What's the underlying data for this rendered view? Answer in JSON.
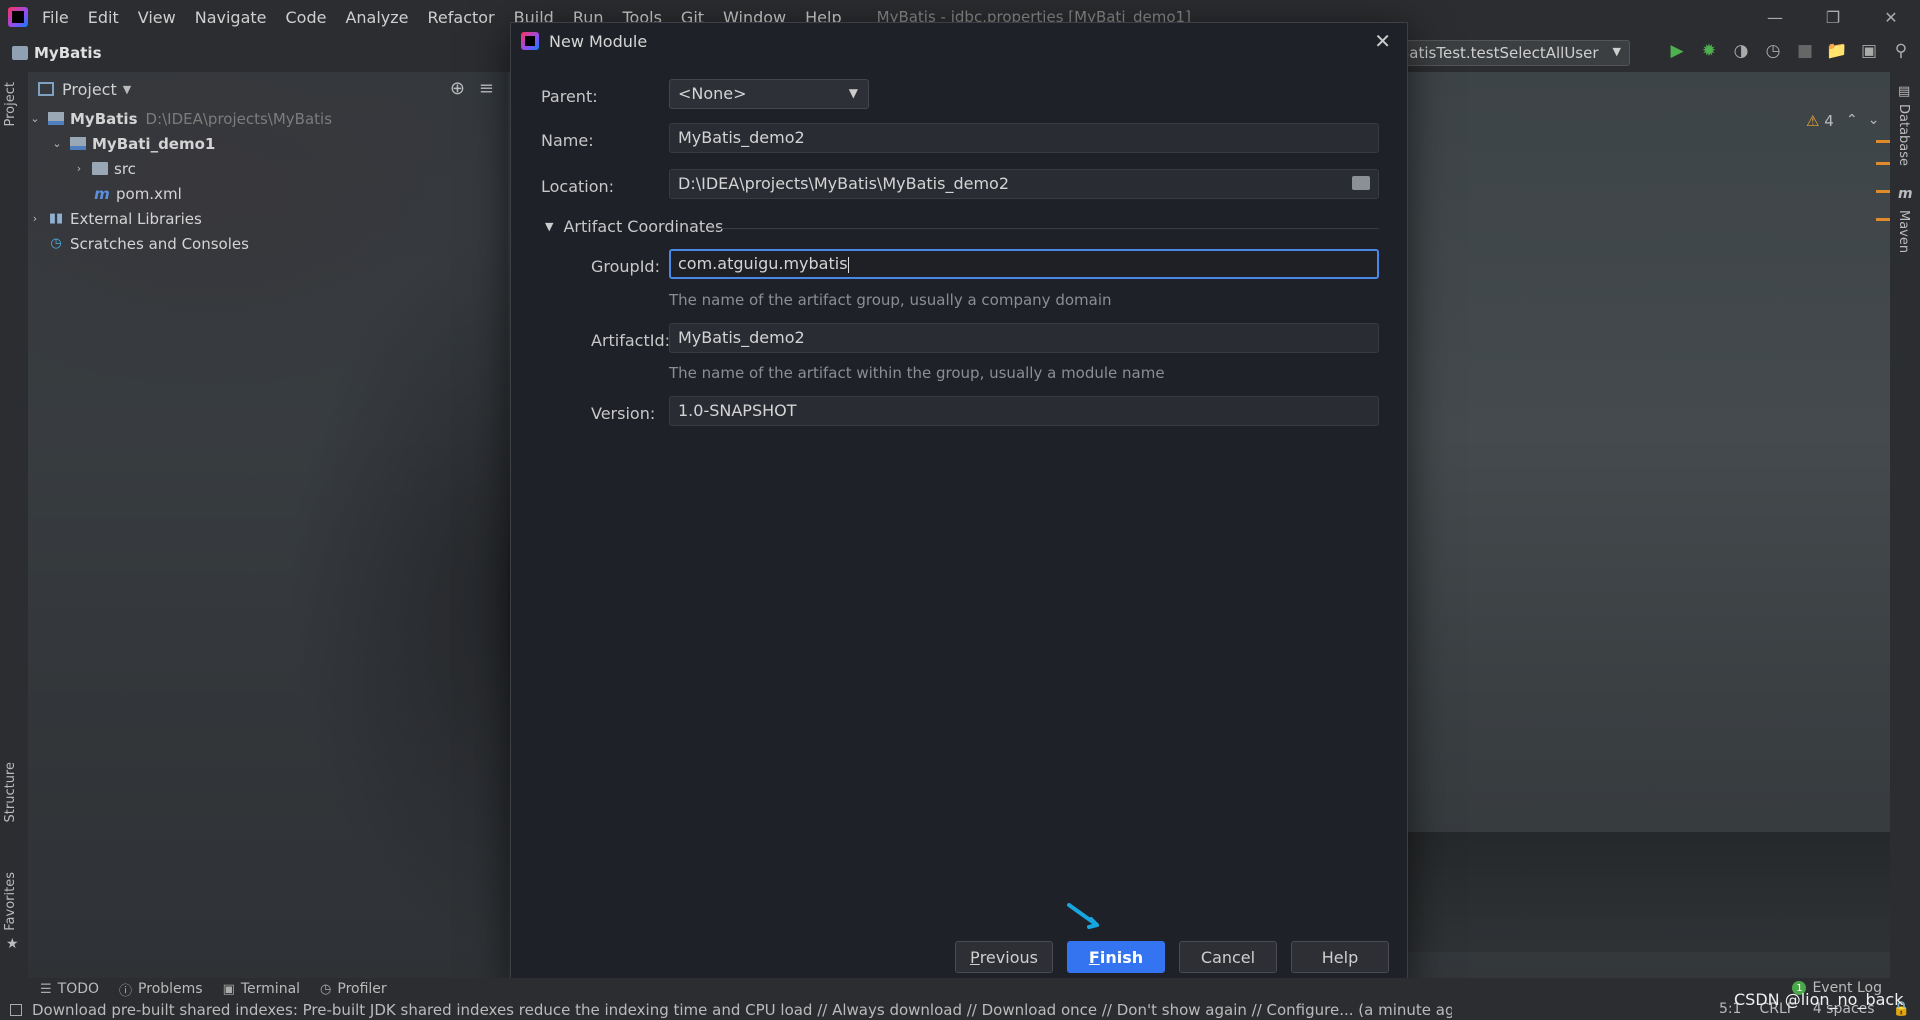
{
  "app": {
    "menu": [
      "File",
      "Edit",
      "View",
      "Navigate",
      "Code",
      "Analyze",
      "Refactor",
      "Build",
      "Run",
      "Tools",
      "Git",
      "Window",
      "Help"
    ],
    "window_title": "MyBatis - jdbc.properties [MyBati_demo1]",
    "breadcrumb": "MyBatis",
    "run_config": "BatisTest.testSelectAllUser"
  },
  "left_strip": {
    "project": "Project",
    "structure": "Structure",
    "favorites": "Favorites"
  },
  "right_strip": {
    "database": "Database",
    "maven": "Maven"
  },
  "project_panel": {
    "title": "Project",
    "tree": [
      {
        "label": "MyBatis",
        "path": "D:\\IDEA\\projects\\MyBatis"
      },
      {
        "label": "MyBati_demo1"
      },
      {
        "label": "src"
      },
      {
        "label": "pom.xml"
      },
      {
        "label": "External Libraries"
      },
      {
        "label": "Scratches and Consoles"
      }
    ]
  },
  "editor": {
    "warning_count": "4"
  },
  "dialog": {
    "title": "New Module",
    "parent_label": "Parent:",
    "parent_value": "<None>",
    "name_label": "Name:",
    "name_value": "MyBatis_demo2",
    "location_label": "Location:",
    "location_value": "D:\\IDEA\\projects\\MyBatis\\MyBatis_demo2",
    "section_title": "Artifact Coordinates",
    "groupid_label": "GroupId:",
    "groupid_value": "com.atguigu.mybatis",
    "groupid_hint": "The name of the artifact group, usually a company domain",
    "artifactid_label": "ArtifactId:",
    "artifactid_value": "MyBatis_demo2",
    "artifactid_hint": "The name of the artifact within the group, usually a module name",
    "version_label": "Version:",
    "version_value": "1.0-SNAPSHOT",
    "buttons": {
      "previous_mnemonic": "P",
      "previous_rest": "revious",
      "finish_mnemonic": "F",
      "finish_rest": "inish",
      "cancel": "Cancel",
      "help": "Help"
    }
  },
  "bottom_tools": [
    "TODO",
    "Problems",
    "Terminal",
    "Profiler"
  ],
  "event_log": {
    "count": "1",
    "label": "Event Log"
  },
  "status": {
    "message": "Download pre-built shared indexes: Pre-built JDK shared indexes reduce the indexing time and CPU load // Always download // Download once // Don't show again // Configure... (a minute ago)",
    "position": "5:1",
    "line_sep": "CRLF",
    "indent": "4 spaces"
  },
  "watermark": "CSDN @lion_no_back",
  "colors": {
    "accent": "#3574f0",
    "focus": "#4a88e8",
    "warning": "#f0a732"
  }
}
